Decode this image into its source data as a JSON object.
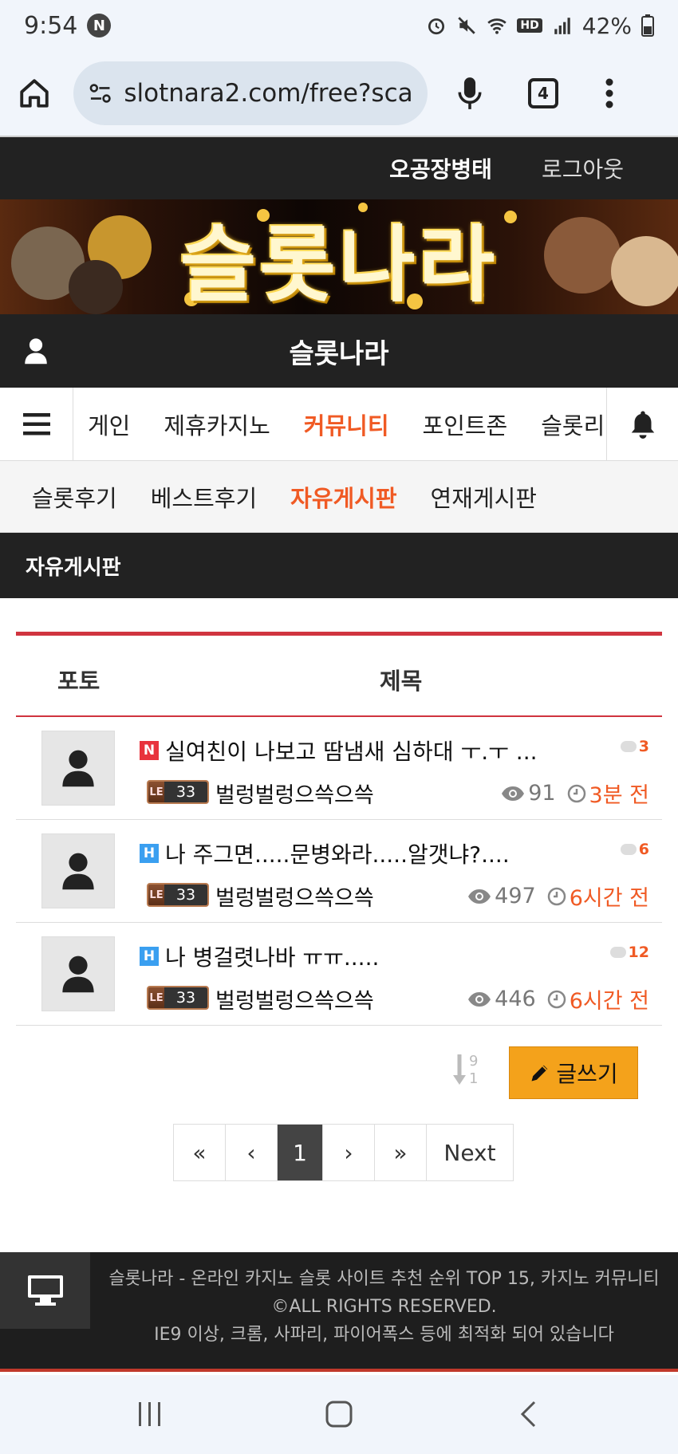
{
  "status_bar": {
    "time": "9:54",
    "notification_badge": "N",
    "battery": "42%",
    "hd_label": "HD"
  },
  "browser": {
    "url": "slotnara2.com/free?sca=",
    "tab_count": "4"
  },
  "topbar": {
    "username": "오공장병태",
    "logout": "로그아웃"
  },
  "banner": {
    "title": "슬롯나라"
  },
  "site": {
    "title": "슬롯나라"
  },
  "main_nav": {
    "items": [
      "게인",
      "제휴카지노",
      "커뮤니티",
      "포인트존",
      "슬롯리"
    ],
    "active": "커뮤니티"
  },
  "sub_nav": {
    "items": [
      "슬롯후기",
      "베스트후기",
      "자유게시판",
      "연재게시판"
    ],
    "active": "자유게시판"
  },
  "board": {
    "name": "자유게시판"
  },
  "list": {
    "header": {
      "photo": "포토",
      "title": "제목"
    },
    "rows": [
      {
        "badge": "N",
        "title": "실여친이 나보고 땀냄새 심하대 ㅜ.ㅜ ...",
        "comments": "3",
        "level": "33",
        "author": "벌렁벌렁으쓱으쓱",
        "views": "91",
        "time": "3분 전"
      },
      {
        "badge": "H",
        "title": "나 주그면.....문병와라.....알갯냐?....",
        "comments": "6",
        "level": "33",
        "author": "벌렁벌렁으쓱으쓱",
        "views": "497",
        "time": "6시간 전"
      },
      {
        "badge": "H",
        "title": "나 병걸렷나바 ㅠㅠ.....",
        "comments": "12",
        "level": "33",
        "author": "벌렁벌렁으쓱으쓱",
        "views": "446",
        "time": "6시간 전"
      }
    ]
  },
  "actions": {
    "sort_top": "9",
    "sort_bottom": "1",
    "write": "글쓰기"
  },
  "pagination": {
    "first": "«",
    "prev": "‹",
    "current": "1",
    "next_arrow": "›",
    "last": "»",
    "next": "Next"
  },
  "footer": {
    "line1": "슬롯나라 - 온라인 카지노 슬롯 사이트 추천 순위 TOP 15, 카지노 커뮤니티",
    "line2": "©ALL RIGHTS RESERVED.",
    "line3": "IE9 이상, 크롬, 사파리, 파이어폭스 등에 최적화 되어 있습니다"
  },
  "colors": {
    "accent": "#f05a24",
    "dark": "#222222",
    "red_line": "#d0343f",
    "write_button": "#f4a21b"
  }
}
